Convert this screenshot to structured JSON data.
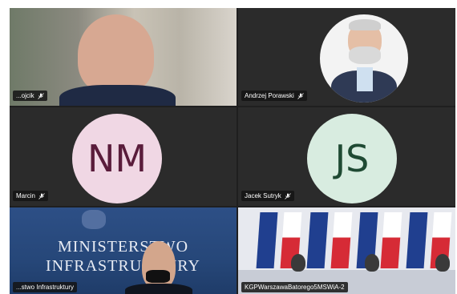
{
  "tiles": [
    {
      "id": "p1",
      "name": "...ojcik",
      "type": "video"
    },
    {
      "id": "p2",
      "name": "Andrzej Porawski",
      "type": "photo-avatar"
    },
    {
      "id": "p3",
      "name": "Marcin",
      "type": "initials",
      "initials": "NM"
    },
    {
      "id": "p4",
      "name": "Jacek Sutryk",
      "type": "initials",
      "initials": "JS"
    },
    {
      "id": "p5",
      "name": "...stwo Infrastruktury",
      "type": "video",
      "banner_line1": "MINISTERSTWO",
      "banner_line2": "INFRASTRUKTURY"
    },
    {
      "id": "p6",
      "name": "KGPWarszawaBatorego5MSWiA-2",
      "type": "video"
    }
  ],
  "icons": {
    "mic": "mic-muted-icon"
  },
  "colors": {
    "tile_bg": "#2b2b2b",
    "nm_bg": "#f0d7e4",
    "nm_fg": "#5a1c3b",
    "js_bg": "#d8ece0",
    "js_fg": "#1f4a33"
  }
}
